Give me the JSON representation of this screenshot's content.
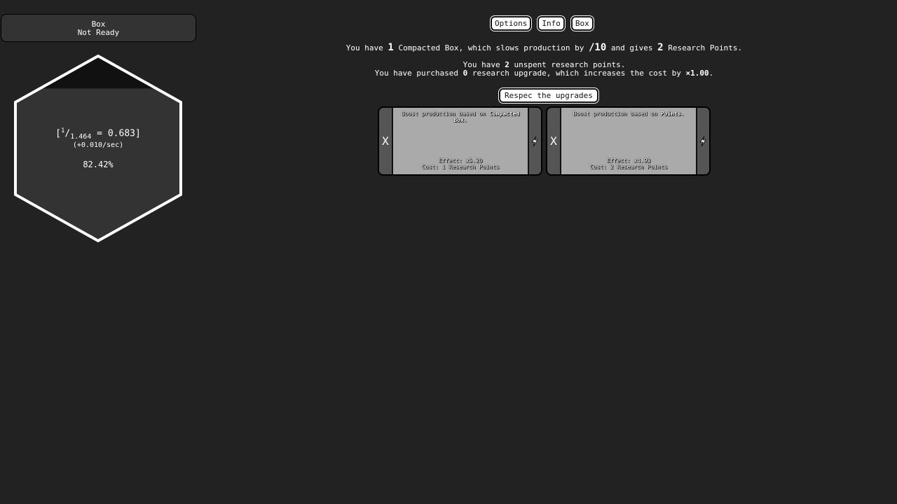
{
  "box_status": {
    "title": "Box",
    "state": "Not Ready"
  },
  "hex": {
    "formula_numerator": "1",
    "formula_denominator": "1.464",
    "formula_result": "0.683",
    "rate": "(+0.010/sec)",
    "percent": "82.42%",
    "progress_fraction": 0.8242
  },
  "nav": {
    "options_label": "Options",
    "info_label": "Info",
    "box_label": "Box"
  },
  "info": {
    "compacted_count": "1",
    "slow_factor": "/10",
    "research_given": "2",
    "unspent_points": "2",
    "purchased_count": "0",
    "cost_multiplier": "×1.00"
  },
  "respec_label": "Respec the upgrades",
  "upgrades": [
    {
      "x_label": "X",
      "desc_prefix": "Boost production based on ",
      "desc_bold": "Compacted Box",
      "desc_suffix": ".",
      "effect": "Effect: x5.20",
      "cost": "Cost: 1 Research Points",
      "bolt_icon": "lightning-icon"
    },
    {
      "x_label": "X",
      "desc_prefix": "Boost production based on ",
      "desc_bold": "Points",
      "desc_suffix": ".",
      "effect": "Effect: x4.93",
      "cost": "Cost: 2 Research Points",
      "bolt_icon": "lightning-icon"
    }
  ],
  "colors": {
    "background": "#222222",
    "panel": "#333333",
    "card_body": "#aaaaaa",
    "card_frame": "#555555",
    "hex_fill_top": "#111111"
  }
}
